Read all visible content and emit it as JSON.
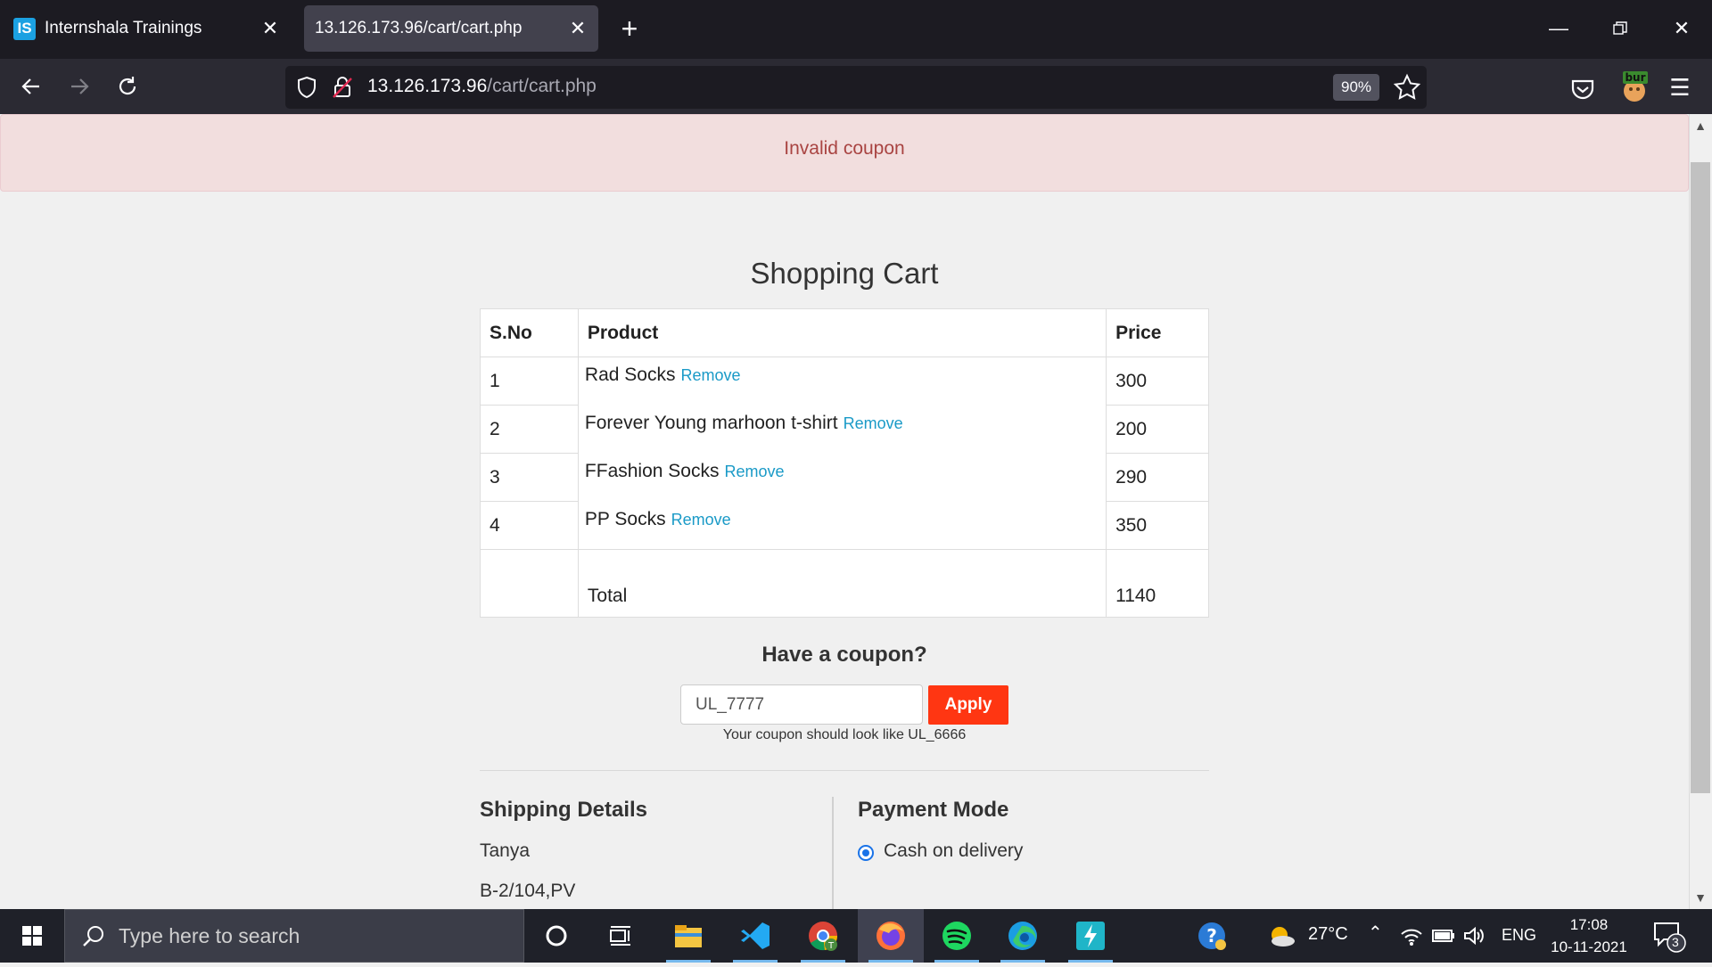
{
  "browser": {
    "tabs": [
      {
        "title": "Internshala Trainings",
        "favicon": "IS"
      },
      {
        "title": "13.126.173.96/cart/cart.php"
      }
    ],
    "url_host": "13.126.173.96",
    "url_path": "/cart/cart.php",
    "zoom": "90%",
    "extension_badge": "bur"
  },
  "page": {
    "alert": "Invalid coupon",
    "cart_title": "Shopping Cart",
    "table": {
      "headers": [
        "S.No",
        "Product",
        "Price"
      ],
      "rows": [
        {
          "sno": "1",
          "product": "Rad Socks",
          "price": "300"
        },
        {
          "sno": "2",
          "product": "Forever Young marhoon t-shirt",
          "price": "200"
        },
        {
          "sno": "3",
          "product": "FFashion Socks",
          "price": "290"
        },
        {
          "sno": "4",
          "product": "PP Socks",
          "price": "350"
        }
      ],
      "remove_label": "Remove",
      "total_label": "Total",
      "total_value": "1140"
    },
    "coupon": {
      "heading": "Have a coupon?",
      "value": "UL_7777",
      "apply_label": "Apply",
      "hint": "Your coupon should look like UL_6666"
    },
    "shipping": {
      "title": "Shipping Details",
      "name": "Tanya",
      "address": "B-2/104,PV"
    },
    "payment": {
      "title": "Payment Mode",
      "option": "Cash on delivery"
    }
  },
  "taskbar": {
    "search_placeholder": "Type here to search",
    "weather": "27°C",
    "language": "ENG",
    "time": "17:08",
    "date": "10-11-2021",
    "notification_count": "3"
  },
  "colors": {
    "alert_bg": "#f2dede",
    "alert_text": "#a94442",
    "link": "#1a9ac7",
    "apply_button": "#ff3612",
    "tab_bar": "#1c1b22"
  }
}
